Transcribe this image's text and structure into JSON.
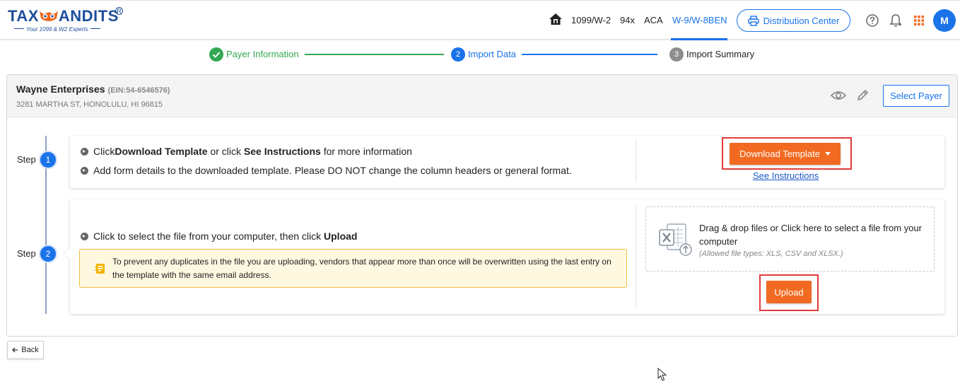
{
  "brand": {
    "logo_left": "TAX",
    "logo_right": "ANDITS",
    "tagline": "Your 1099 & W2 Experts",
    "colors": {
      "primary": "#1f4e9b",
      "accent": "#f26a21",
      "link": "#1a73e8"
    }
  },
  "header": {
    "nav": [
      "1099/W-2",
      "94x",
      "ACA",
      "W-9/W-8BEN"
    ],
    "active_nav": "W-9/W-8BEN",
    "distribution_center": "Distribution Center",
    "avatar_initial": "M",
    "icons": [
      "home-icon",
      "printer-icon",
      "help-icon",
      "bell-icon",
      "apps-grid-icon"
    ]
  },
  "stepper": {
    "steps": [
      {
        "label": "Payer Information",
        "status": "completed",
        "number": ""
      },
      {
        "label": "Import Data",
        "status": "active",
        "number": "2"
      },
      {
        "label": "Import Summary",
        "status": "pending",
        "number": "3"
      }
    ]
  },
  "payer": {
    "name": "Wayne Enterprises",
    "ein": "(EIN:54-6546576)",
    "address": "3281 MARTHA ST, HONOLULU, HI 96815",
    "select_button": "Select Payer"
  },
  "steps": {
    "label": "Step",
    "step1": {
      "number": "1",
      "line1_pre": "Click ",
      "line1_b1": "Download Template",
      "line1_mid": " or click ",
      "line1_b2": "See Instructions",
      "line1_post": " for more information",
      "line2": "Add form details to the downloaded template. Please DO NOT change the column headers or general format.",
      "download_button": "Download Template",
      "instructions_link": "See Instructions"
    },
    "step2": {
      "number": "2",
      "line1_pre": "Click to select the file from your computer, then click ",
      "line1_b": "Upload",
      "notice": "To prevent any duplicates in the file you are uploading, vendors that appear more than once will be overwritten using the last entry on the template with the same email address.",
      "dropzone_text": "Drag & drop files or Click here to select a file from your computer",
      "dropzone_types": "(Allowed file types: XLS, CSV and XLSX.)",
      "upload_button": "Upload"
    }
  },
  "footer": {
    "back_button": "Back"
  }
}
